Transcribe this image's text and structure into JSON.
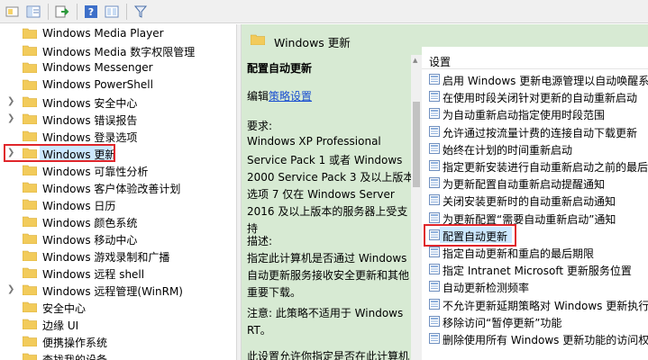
{
  "toolbar": {
    "buttons": [
      "back-icon",
      "forward-icon",
      "show-hide-tree-icon",
      "export-list-icon",
      "help-icon",
      "properties-icon",
      "filter-icon"
    ]
  },
  "tree": {
    "items": [
      {
        "label": "Windows Media Player",
        "expandable": false
      },
      {
        "label": "Windows Media 数字权限管理",
        "expandable": false
      },
      {
        "label": "Windows Messenger",
        "expandable": false
      },
      {
        "label": "Windows PowerShell",
        "expandable": false
      },
      {
        "label": "Windows 安全中心",
        "expandable": true
      },
      {
        "label": "Windows 错误报告",
        "expandable": true
      },
      {
        "label": "Windows 登录选项",
        "expandable": false
      },
      {
        "label": "Windows 更新",
        "expandable": true,
        "selected": true
      },
      {
        "label": "Windows 可靠性分析",
        "expandable": false
      },
      {
        "label": "Windows 客户体验改善计划",
        "expandable": false
      },
      {
        "label": "Windows 日历",
        "expandable": false
      },
      {
        "label": "Windows 颜色系统",
        "expandable": false
      },
      {
        "label": "Windows 移动中心",
        "expandable": false
      },
      {
        "label": "Windows 游戏录制和广播",
        "expandable": false
      },
      {
        "label": "Windows 远程 shell",
        "expandable": false
      },
      {
        "label": "Windows 远程管理(WinRM)",
        "expandable": true
      },
      {
        "label": "安全中心",
        "expandable": false
      },
      {
        "label": "边缘 UI",
        "expandable": false
      },
      {
        "label": "便携操作系统",
        "expandable": false
      },
      {
        "label": "查找我的设备",
        "expandable": false
      }
    ]
  },
  "right_pane": {
    "header_title": "Windows 更新",
    "description": {
      "setting_title": "配置自动更新",
      "edit_prefix": "编辑",
      "edit_link": "策略设置",
      "requirements_label": "要求:",
      "requirements_lines": [
        "Windows XP Professional",
        "Service Pack 1 或者 Windows",
        "2000 Service Pack 3 及以上版本",
        "选项 7 仅在 Windows Server",
        "2016 及以上版本的服务器上受支",
        "持"
      ],
      "desc_label": "描述:",
      "desc_lines": [
        "指定此计算机是否通过 Windows",
        "自动更新服务接收安全更新和其他",
        "重要下载。"
      ],
      "note_lines": [
        "注意: 此策略不适用于 Windows",
        "RT。"
      ],
      "last_line": "此设置允许你指定是否在此计算机"
    },
    "list": {
      "column_header": "设置",
      "items": [
        "启用 Windows 更新电源管理以自动唤醒系统",
        "在使用时段关闭针对更新的自动重新启动",
        "为自动重新启动指定使用时段范围",
        "允许通过按流量计费的连接自动下载更新",
        "始终在计划的时间重新启动",
        "指定更新安装进行自动重新启动之前的最后期限",
        "为更新配置自动重新启动提醒通知",
        "关闭安装更新时的自动重新启动通知",
        "为更新配置“需要自动重新启动”通知",
        "配置自动更新",
        "指定自动更新和重启的最后期限",
        "指定 Intranet Microsoft 更新服务位置",
        "自动更新检测频率",
        "不允许更新延期策略对 Windows 更新执行扫描",
        "移除访问“暂停更新”功能",
        "删除使用所有 Windows 更新功能的访问权限"
      ],
      "selected_index": 9
    }
  }
}
